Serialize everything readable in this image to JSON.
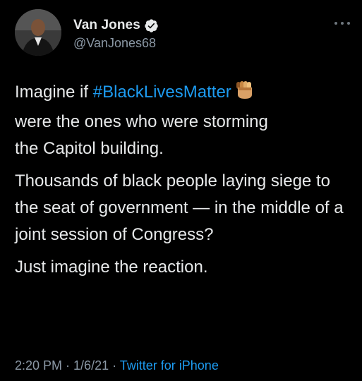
{
  "tweet": {
    "author": {
      "display_name": "Van Jones",
      "handle": "@VanJones68",
      "verified": true
    },
    "more_icon": "more-dots-icon",
    "text": {
      "p1_prefix": "Imagine if ",
      "hashtag": "#BlackLivesMatter",
      "emoji": "raised-fist-emoji",
      "p1_rest_line2": "were the ones who were storming",
      "p1_rest_line3": "the Capitol building.",
      "p2": "Thousands of black people laying siege to the seat of government — in the middle of a joint session of Congress?",
      "p3": "Just imagine the reaction."
    },
    "meta": {
      "time": "2:20 PM",
      "sep1": " · ",
      "date": "1/6/21",
      "sep2": " · ",
      "source": "Twitter for iPhone"
    }
  },
  "colors": {
    "background": "#000000",
    "text": "#e7e9ea",
    "secondary": "#8b98a5",
    "link": "#1d9bf0"
  }
}
